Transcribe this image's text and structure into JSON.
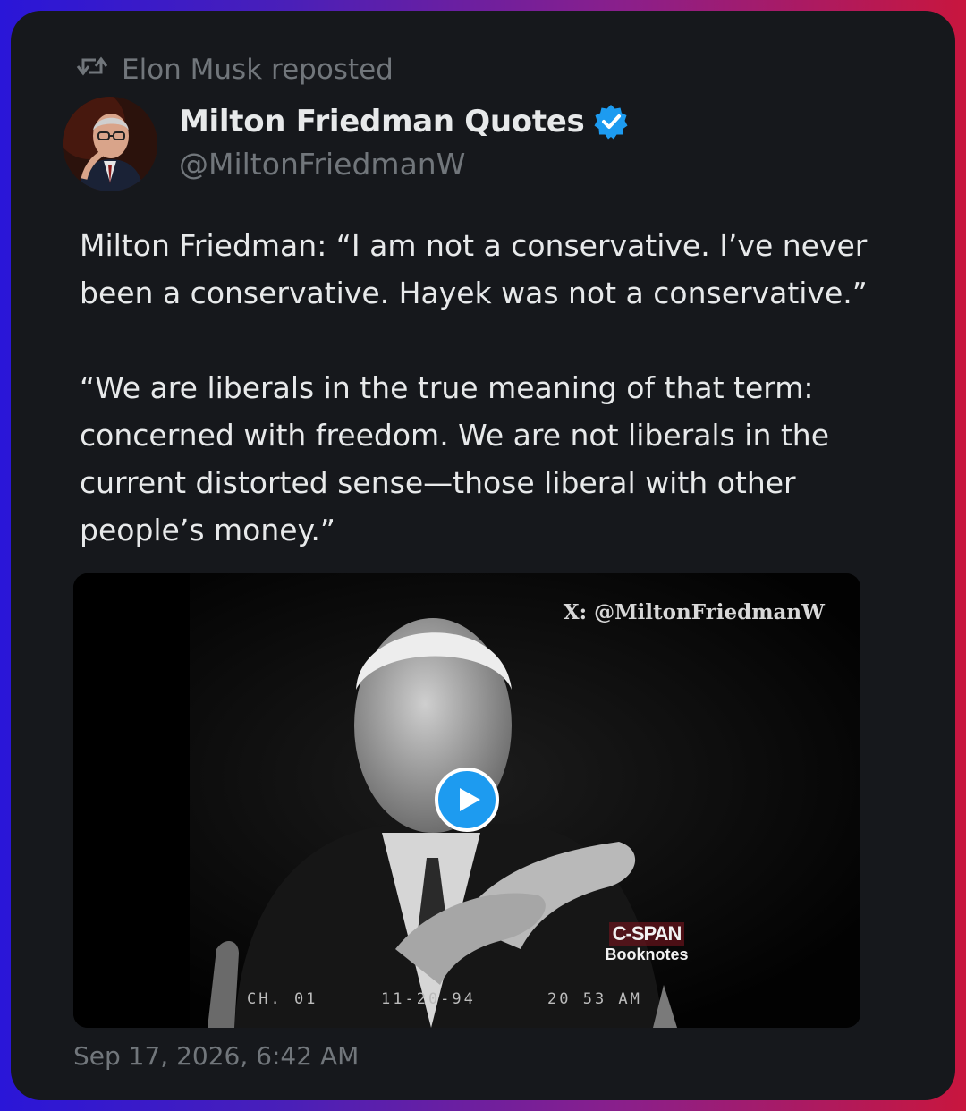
{
  "repost": {
    "icon": "repost-icon",
    "label": "Elon Musk reposted"
  },
  "author": {
    "name": "Milton Friedman Quotes",
    "handle": "@MiltonFriedmanW",
    "verified": true,
    "verified_color": "#1d9bf0"
  },
  "tweet": {
    "paragraphs": [
      "Milton Friedman: “I am not a conservative. I’ve never been a conservative. Hayek was not a conservative.”",
      "“We are liberals in the true meaning of that term: concerned with freedom. We are not liberals in the current distorted sense—those liberal with other people’s money.”"
    ]
  },
  "media": {
    "watermark": "X: @MiltonFriedmanW",
    "play_icon": "play-icon",
    "broadcast_logo": {
      "line1": "C-SPAN",
      "line2": "Booknotes"
    },
    "overlay": {
      "channel": "CH. 01",
      "date": "11-20-94",
      "time": "20 53 AM"
    }
  },
  "timestamp": "Sep 17, 2026, 6:42 AM",
  "colors": {
    "card_bg": "#16181c",
    "text_primary": "#e7e9ea",
    "text_secondary": "#71767b",
    "accent": "#1d9bf0"
  }
}
